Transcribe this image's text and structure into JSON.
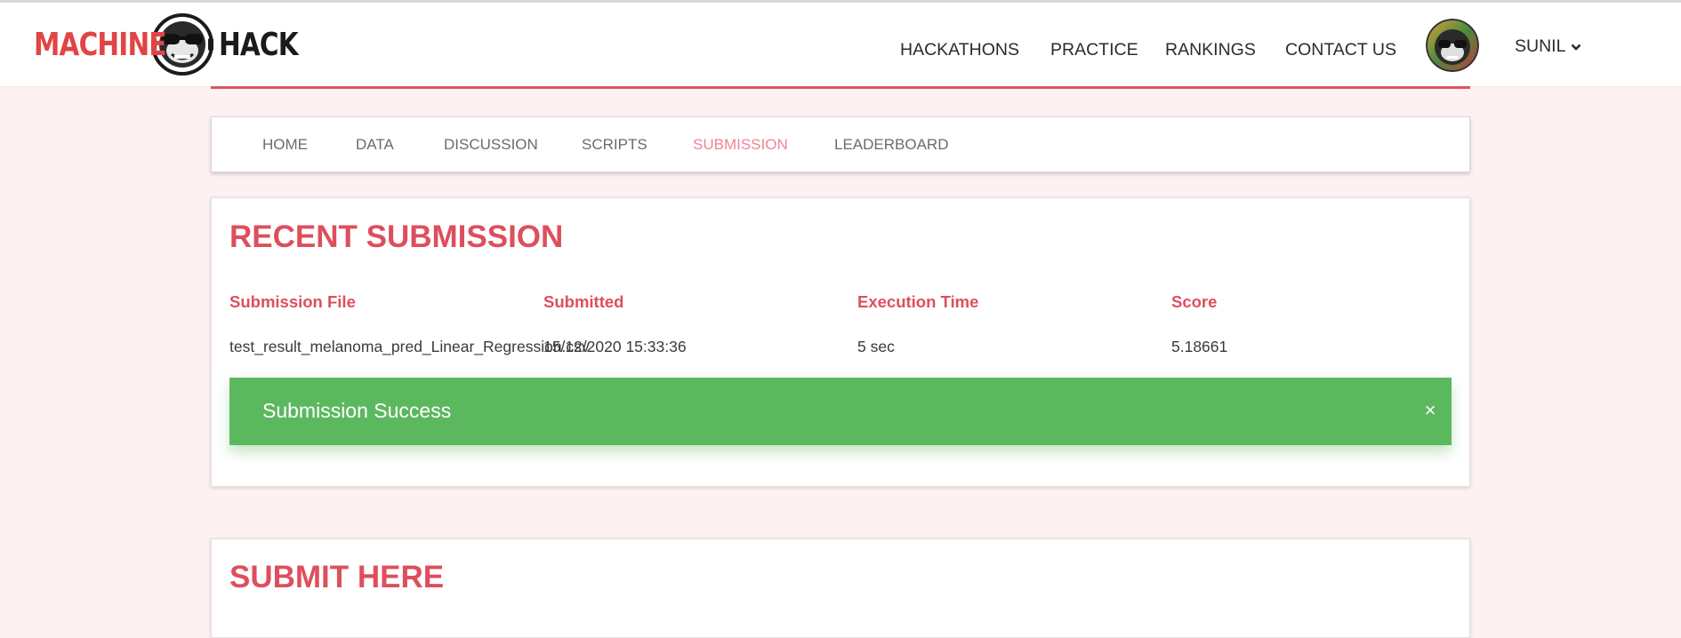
{
  "header": {
    "logo": {
      "part1": "MACHINE",
      "part2": "HACK"
    },
    "nav": [
      {
        "label": "HACKATHONS"
      },
      {
        "label": "PRACTICE"
      },
      {
        "label": "RANKINGS"
      },
      {
        "label": "CONTACT US"
      }
    ],
    "user": {
      "name": "SUNIL"
    }
  },
  "tabs": [
    {
      "label": "HOME",
      "active": false
    },
    {
      "label": "DATA",
      "active": false
    },
    {
      "label": "DISCUSSION",
      "active": false
    },
    {
      "label": "SCRIPTS",
      "active": false
    },
    {
      "label": "SUBMISSION",
      "active": true
    },
    {
      "label": "LEADERBOARD",
      "active": false
    }
  ],
  "recent_submission": {
    "title": "RECENT SUBMISSION",
    "columns": [
      "Submission File",
      "Submitted",
      "Execution Time",
      "Score"
    ],
    "row": {
      "file": "test_result_melanoma_pred_Linear_Regression.csv",
      "submitted": "15/12/2020 15:33:36",
      "execution_time": "5 sec",
      "score": "5.18661"
    },
    "alert": {
      "message": "Submission Success",
      "close": "×"
    }
  },
  "submit_here": {
    "title": "SUBMIT HERE"
  },
  "colors": {
    "brand_red": "#dd4f5d",
    "active_tab": "#ef8496",
    "success_green": "#5cb85f",
    "page_bg": "#fdf1f2"
  }
}
